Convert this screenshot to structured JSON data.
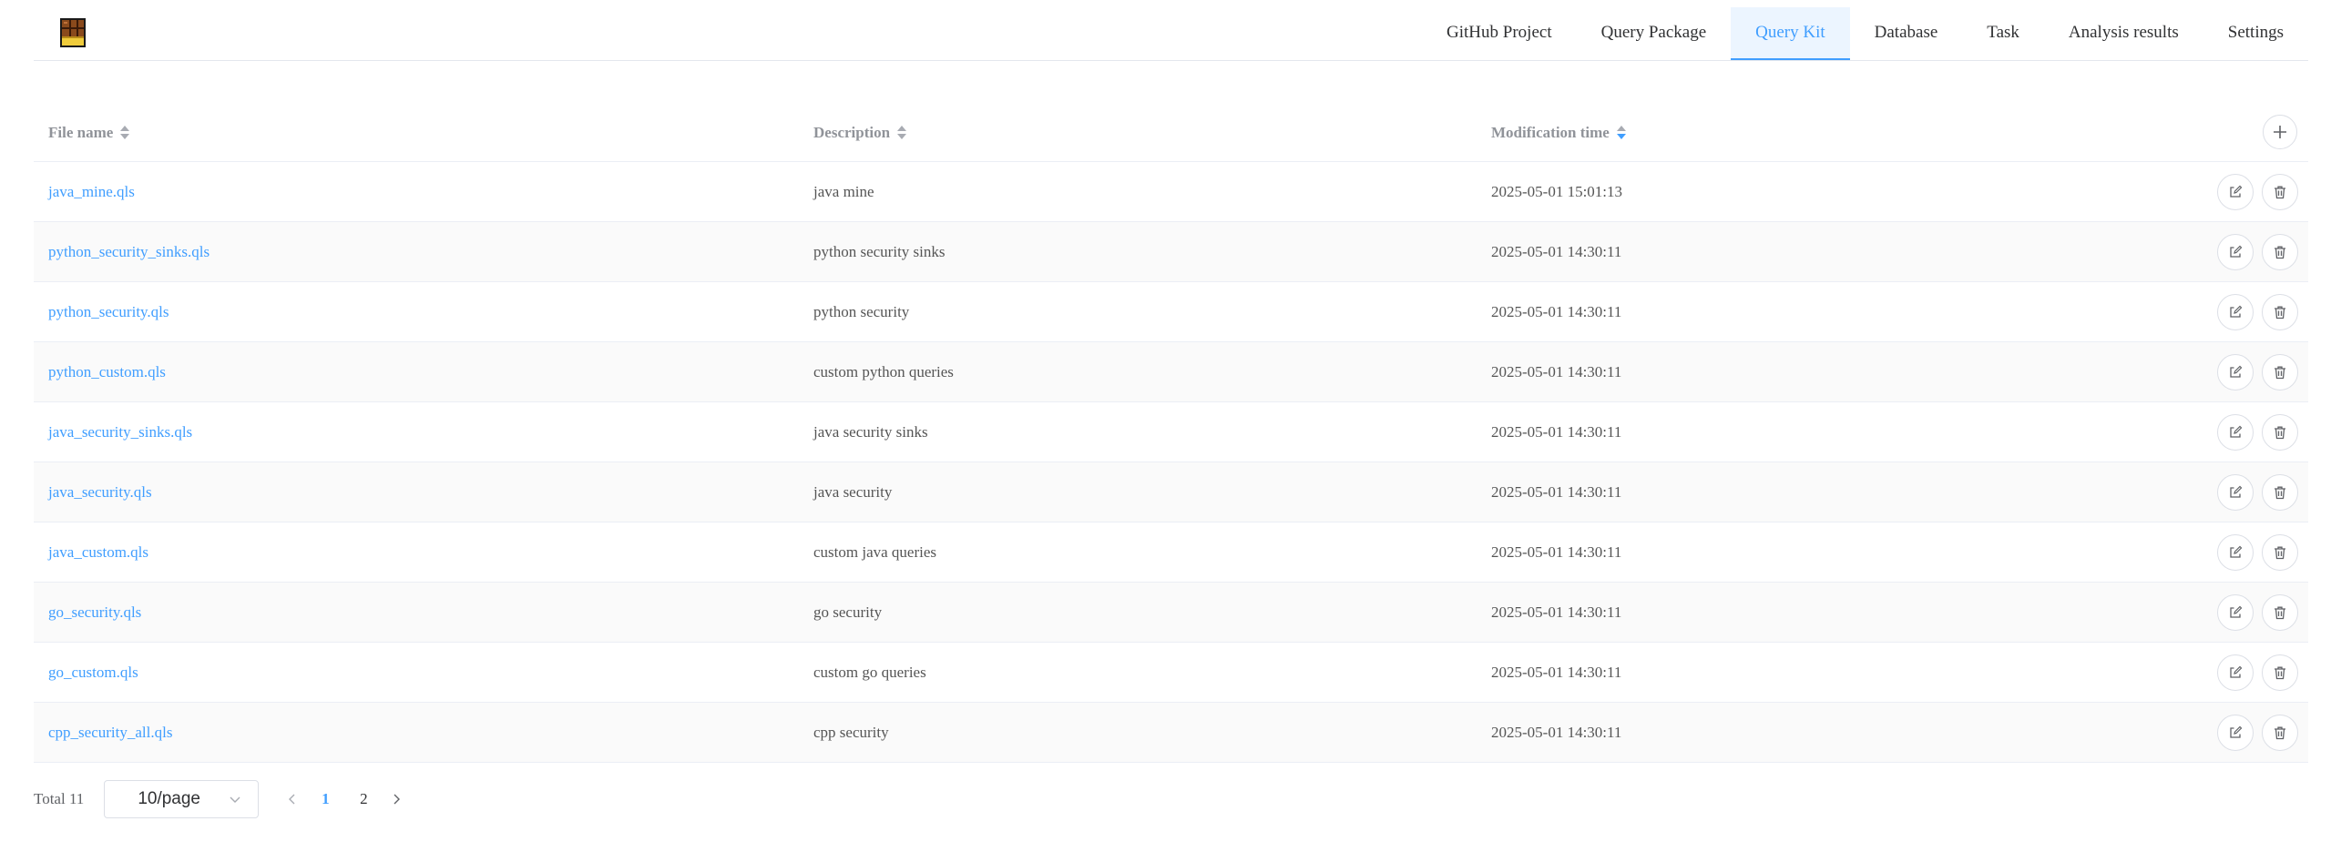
{
  "nav": {
    "items": [
      {
        "label": "GitHub Project",
        "active": false
      },
      {
        "label": "Query Package",
        "active": false
      },
      {
        "label": "Query Kit",
        "active": true
      },
      {
        "label": "Database",
        "active": false
      },
      {
        "label": "Task",
        "active": false
      },
      {
        "label": "Analysis results",
        "active": false
      },
      {
        "label": "Settings",
        "active": false
      }
    ]
  },
  "table": {
    "columns": [
      {
        "label": "File name",
        "sort_active": false
      },
      {
        "label": "Description",
        "sort_active": false
      },
      {
        "label": "Modification time",
        "sort_active": true,
        "sort_direction": "descending"
      }
    ],
    "rows": [
      {
        "file": "java_mine.qls",
        "description": "java mine",
        "time": "2025-05-01 15:01:13"
      },
      {
        "file": "python_security_sinks.qls",
        "description": "python security sinks",
        "time": "2025-05-01 14:30:11"
      },
      {
        "file": "python_security.qls",
        "description": "python security",
        "time": "2025-05-01 14:30:11"
      },
      {
        "file": "python_custom.qls",
        "description": "custom python queries",
        "time": "2025-05-01 14:30:11"
      },
      {
        "file": "java_security_sinks.qls",
        "description": "java security sinks",
        "time": "2025-05-01 14:30:11"
      },
      {
        "file": "java_security.qls",
        "description": "java security",
        "time": "2025-05-01 14:30:11"
      },
      {
        "file": "java_custom.qls",
        "description": "custom java queries",
        "time": "2025-05-01 14:30:11"
      },
      {
        "file": "go_security.qls",
        "description": "go security",
        "time": "2025-05-01 14:30:11"
      },
      {
        "file": "go_custom.qls",
        "description": "custom go queries",
        "time": "2025-05-01 14:30:11"
      },
      {
        "file": "cpp_security_all.qls",
        "description": "cpp security",
        "time": "2025-05-01 14:30:11"
      }
    ]
  },
  "pagination": {
    "total_label": "Total 11",
    "page_size": "10/page",
    "pages": [
      "1",
      "2"
    ],
    "current_page": "1"
  },
  "colors": {
    "accent": "#409eff",
    "nav_active_bg": "#ecf5ff",
    "stripe": "#fafafa",
    "border": "#ebeef5"
  },
  "icons": {
    "logo": "chocolate-bar-icon",
    "add": "plus-icon",
    "edit": "edit-icon",
    "delete": "trash-icon",
    "prev": "chevron-left-icon",
    "next": "chevron-right-icon",
    "select": "chevron-down-icon"
  }
}
